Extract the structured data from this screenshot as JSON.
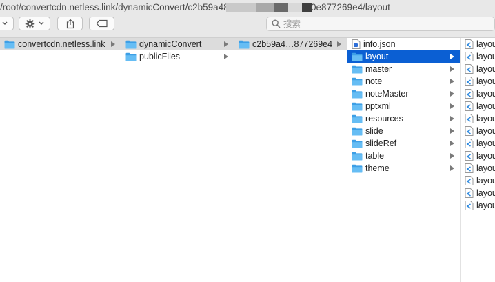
{
  "window": {
    "path_start": "/root/convertcdn.netless.link/dynamicConvert/c2b59a480",
    "path_end": "0e877269e4/layout"
  },
  "toolbar": {
    "view_icon": "column-view-icon",
    "action_icon": "gear-icon",
    "share_icon": "share-icon",
    "tag_icon": "tag-icon",
    "search_placeholder": "搜索"
  },
  "colors": {
    "folder": "#55b6f2",
    "selection_active": "#0b5fd3",
    "selection_inactive": "#dcdcdc"
  },
  "columns": [
    {
      "items": [
        {
          "label": "convertcdn.netless.link",
          "kind": "folder",
          "arrow": true,
          "selected": "grey"
        }
      ]
    },
    {
      "items": [
        {
          "label": "dynamicConvert",
          "kind": "folder",
          "arrow": true,
          "selected": "grey"
        },
        {
          "label": "publicFiles",
          "kind": "folder",
          "arrow": true,
          "selected": ""
        }
      ]
    },
    {
      "items": [
        {
          "label": "c2b59a4…877269e4",
          "kind": "folder",
          "arrow": true,
          "selected": "grey"
        }
      ]
    },
    {
      "items": [
        {
          "label": "info.json",
          "kind": "json",
          "arrow": false,
          "selected": ""
        },
        {
          "label": "layout",
          "kind": "folder",
          "arrow": true,
          "selected": "blue"
        },
        {
          "label": "master",
          "kind": "folder",
          "arrow": true,
          "selected": ""
        },
        {
          "label": "note",
          "kind": "folder",
          "arrow": true,
          "selected": ""
        },
        {
          "label": "noteMaster",
          "kind": "folder",
          "arrow": true,
          "selected": ""
        },
        {
          "label": "pptxml",
          "kind": "folder",
          "arrow": true,
          "selected": ""
        },
        {
          "label": "resources",
          "kind": "folder",
          "arrow": true,
          "selected": ""
        },
        {
          "label": "slide",
          "kind": "folder",
          "arrow": true,
          "selected": ""
        },
        {
          "label": "slideRef",
          "kind": "folder",
          "arrow": true,
          "selected": ""
        },
        {
          "label": "table",
          "kind": "folder",
          "arrow": true,
          "selected": ""
        },
        {
          "label": "theme",
          "kind": "folder",
          "arrow": true,
          "selected": ""
        }
      ]
    },
    {
      "items": [
        {
          "label": "layout",
          "kind": "code",
          "arrow": false,
          "selected": ""
        },
        {
          "label": "layout",
          "kind": "code",
          "arrow": false,
          "selected": ""
        },
        {
          "label": "layout",
          "kind": "code",
          "arrow": false,
          "selected": ""
        },
        {
          "label": "layout",
          "kind": "code",
          "arrow": false,
          "selected": ""
        },
        {
          "label": "layout",
          "kind": "code",
          "arrow": false,
          "selected": ""
        },
        {
          "label": "layout",
          "kind": "code",
          "arrow": false,
          "selected": ""
        },
        {
          "label": "layout",
          "kind": "code",
          "arrow": false,
          "selected": ""
        },
        {
          "label": "layout",
          "kind": "code",
          "arrow": false,
          "selected": ""
        },
        {
          "label": "layout",
          "kind": "code",
          "arrow": false,
          "selected": ""
        },
        {
          "label": "layout",
          "kind": "code",
          "arrow": false,
          "selected": ""
        },
        {
          "label": "layout",
          "kind": "code",
          "arrow": false,
          "selected": ""
        },
        {
          "label": "layout",
          "kind": "code",
          "arrow": false,
          "selected": ""
        },
        {
          "label": "layout",
          "kind": "code",
          "arrow": false,
          "selected": ""
        },
        {
          "label": "layout",
          "kind": "code",
          "arrow": false,
          "selected": ""
        }
      ]
    }
  ]
}
